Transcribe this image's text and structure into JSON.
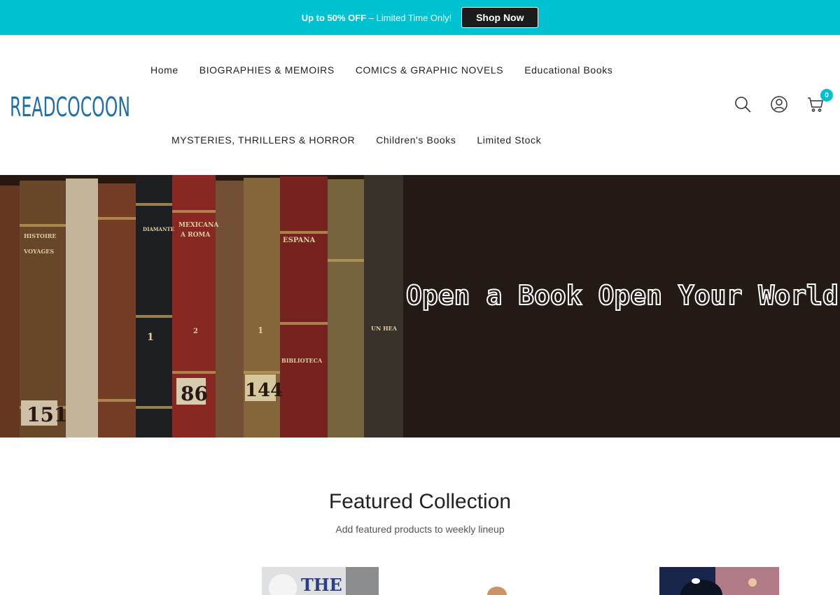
{
  "announcement": {
    "offer": "Up to 50% OFF",
    "rest": " – Limited Time Only!",
    "button": "Shop Now"
  },
  "header": {
    "logo_text": "READCOCOON",
    "nav_row1": [
      "Home",
      "BIOGRAPHIES & MEMOIRS",
      "COMICS & GRAPHIC NOVELS",
      "Educational Books"
    ],
    "nav_row2": [
      "MYSTERIES, THRILLERS & HORROR",
      "Children's Books",
      "Limited Stock"
    ],
    "cart_count": "0"
  },
  "hero": {
    "headline": "Open a Book Open Your World"
  },
  "featured": {
    "title": "Featured Collection",
    "subtitle": "Add featured products to weekly lineup",
    "product1_cover_text": "THE"
  },
  "colors": {
    "accent": "#00c1cf",
    "hero_bg": "#231a16",
    "logo": "#1f6fa8"
  },
  "icons": [
    "search-icon",
    "account-icon",
    "cart-icon"
  ]
}
